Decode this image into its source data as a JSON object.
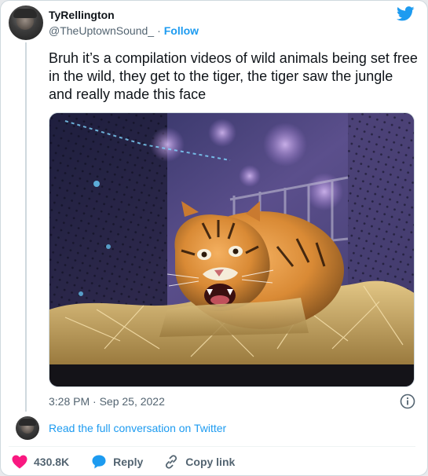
{
  "author": {
    "display_name": "TyRellington",
    "handle": "@TheUptownSound_",
    "separator": "·",
    "follow_label": "Follow"
  },
  "tweet": {
    "text": "Bruh it’s a compilation videos of wild animals being set free in the wild, they get to the tiger, the tiger saw the jungle and really made this face",
    "timestamp": "3:28 PM · Sep 25, 2022",
    "media_description": "tiger-in-transport-cage-photo"
  },
  "conversation": {
    "read_more_label": "Read the full conversation on Twitter"
  },
  "actions": {
    "like_count": "430.8K",
    "reply_label": "Reply",
    "copy_label": "Copy link"
  },
  "colors": {
    "accent": "#1d9bf0",
    "like": "#f91880",
    "text": "#0f1419",
    "muted": "#536471",
    "border": "#cfd9de"
  },
  "icons": {
    "brand": "twitter-bird-icon",
    "like": "heart-icon",
    "reply": "speech-bubble-icon",
    "copy": "link-icon",
    "info": "info-icon"
  }
}
